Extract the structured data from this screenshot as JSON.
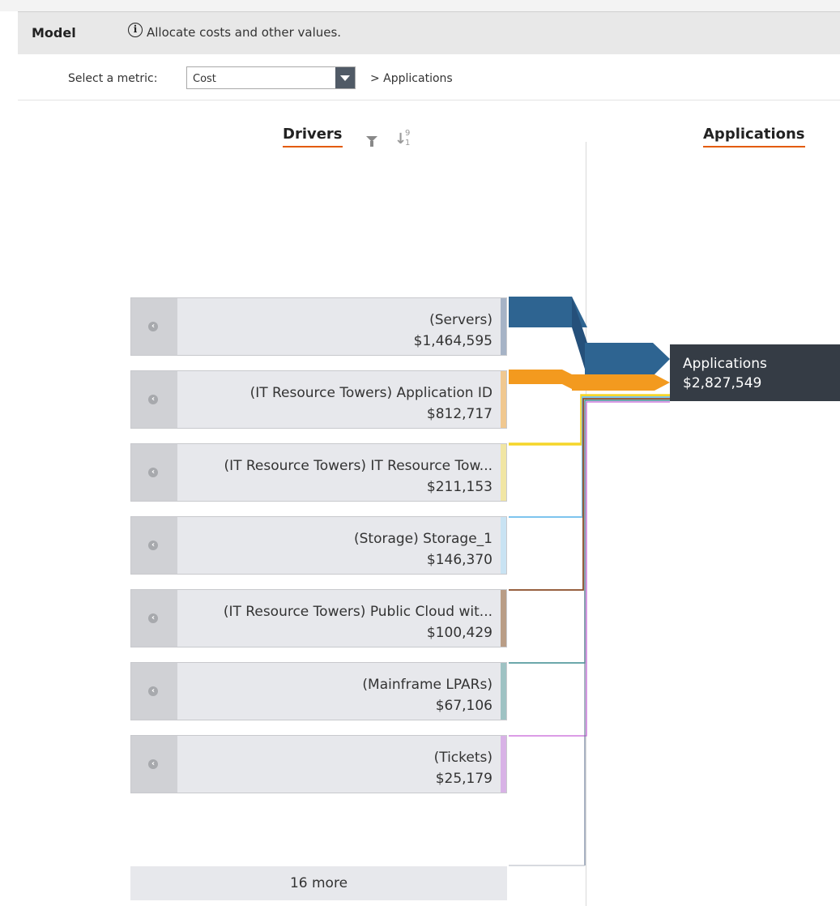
{
  "header": {
    "title": "Model",
    "description": "Allocate costs and other values."
  },
  "metric": {
    "label": "Select a metric:",
    "selected": "Cost",
    "breadcrumb": "> Applications"
  },
  "columns": {
    "drivers": "Drivers",
    "applications": "Applications"
  },
  "drivers": [
    {
      "name": "(Servers)",
      "value": "$1,464,595",
      "color": "#a6b3c6"
    },
    {
      "name": "(IT Resource Towers) Application ID",
      "value": "$812,717",
      "color": "#f0c890"
    },
    {
      "name": "(IT Resource Towers) IT Resource Tow...",
      "value": "$211,153",
      "color": "#f1e6a4"
    },
    {
      "name": "(Storage) Storage_1",
      "value": "$146,370",
      "color": "#c9e3f3"
    },
    {
      "name": "(IT Resource Towers) Public Cloud wit...",
      "value": "$100,429",
      "color": "#b99d86"
    },
    {
      "name": "(Mainframe LPARs)",
      "value": "$67,106",
      "color": "#9ec2c3"
    },
    {
      "name": "(Tickets)",
      "value": "$25,179",
      "color": "#d8b2e6"
    }
  ],
  "more": "16 more",
  "target": {
    "label": "Applications",
    "value": "$2,827,549"
  },
  "flow_colors": {
    "servers": "#2e6491",
    "app_id": "#f39a1f",
    "it_resource": "#f5d52a",
    "storage": "#7ec4ee",
    "public_cloud": "#8a4b26",
    "mainframe": "#3b8c8f",
    "tickets": "#c560d8"
  }
}
